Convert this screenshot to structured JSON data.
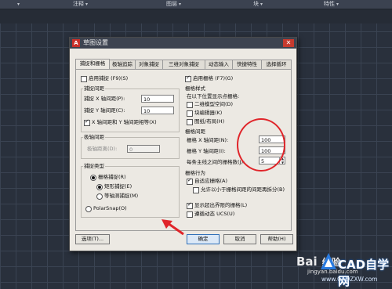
{
  "ribbon": [
    "注释",
    "图层",
    "块",
    "特性"
  ],
  "dialog": {
    "title": "草图设置",
    "app_icon": "A",
    "close": "✕",
    "tabs": [
      "捕捉和栅格",
      "极轴追踪",
      "对象捕捉",
      "三维对象捕捉",
      "动态输入",
      "快捷特性",
      "选择循环"
    ],
    "snap_on_label": "启用捕捉 (F9)(S)",
    "snap_spacing": {
      "title": "捕捉间距",
      "x_label": "捕捉 X 轴间距(P):",
      "x_value": "10",
      "y_label": "捕捉 Y 轴间距(C):",
      "y_value": "10",
      "equal_label": "X 轴间距和 Y 轴间距相等(X)"
    },
    "polar_spacing": {
      "title": "极轴间距",
      "distance_label": "极轴距离(D):",
      "distance_value": "0"
    },
    "snap_type": {
      "title": "捕捉类型",
      "grid_snap": "栅格捕捉(R)",
      "rect_snap": "矩形捕捉(E)",
      "iso_snap": "等轴测捕捉(M)",
      "polar_snap": "PolarSnap(O)"
    },
    "grid_on_label": "启用栅格 (F7)(G)",
    "grid_style": {
      "title": "栅格样式",
      "subtitle": "在以下位置显示点栅格:",
      "model_space": "二维模型空间(D)",
      "block_editor": "块编辑器(K)",
      "sheet_layout": "图纸/布局(H)"
    },
    "grid_spacing": {
      "title": "栅格间距",
      "x_label": "栅格 X 轴间距(N):",
      "x_value": "100",
      "y_label": "栅格 Y 轴间距(I):",
      "y_value": "100",
      "major_label": "每条主线之间的栅格数(J):",
      "major_value": "5"
    },
    "grid_behavior": {
      "title": "栅格行为",
      "adaptive": "自适应栅格(A)",
      "subdivide": "允许以小于栅格间距的间距再拆分(B)",
      "beyond_limits": "显示超出界限的栅格(L)",
      "follow_ucs": "遵循动态 UCS(U)"
    },
    "options_btn": "选项(T)...",
    "ok_btn": "确定",
    "cancel_btn": "取消",
    "help_btn": "帮助(H)"
  },
  "watermark": {
    "baidu": "Bai",
    "exp": "经验",
    "url": "jingyan.baidu.com",
    "site": "CAD自学网",
    "domain": "www.CADZXW.com"
  }
}
